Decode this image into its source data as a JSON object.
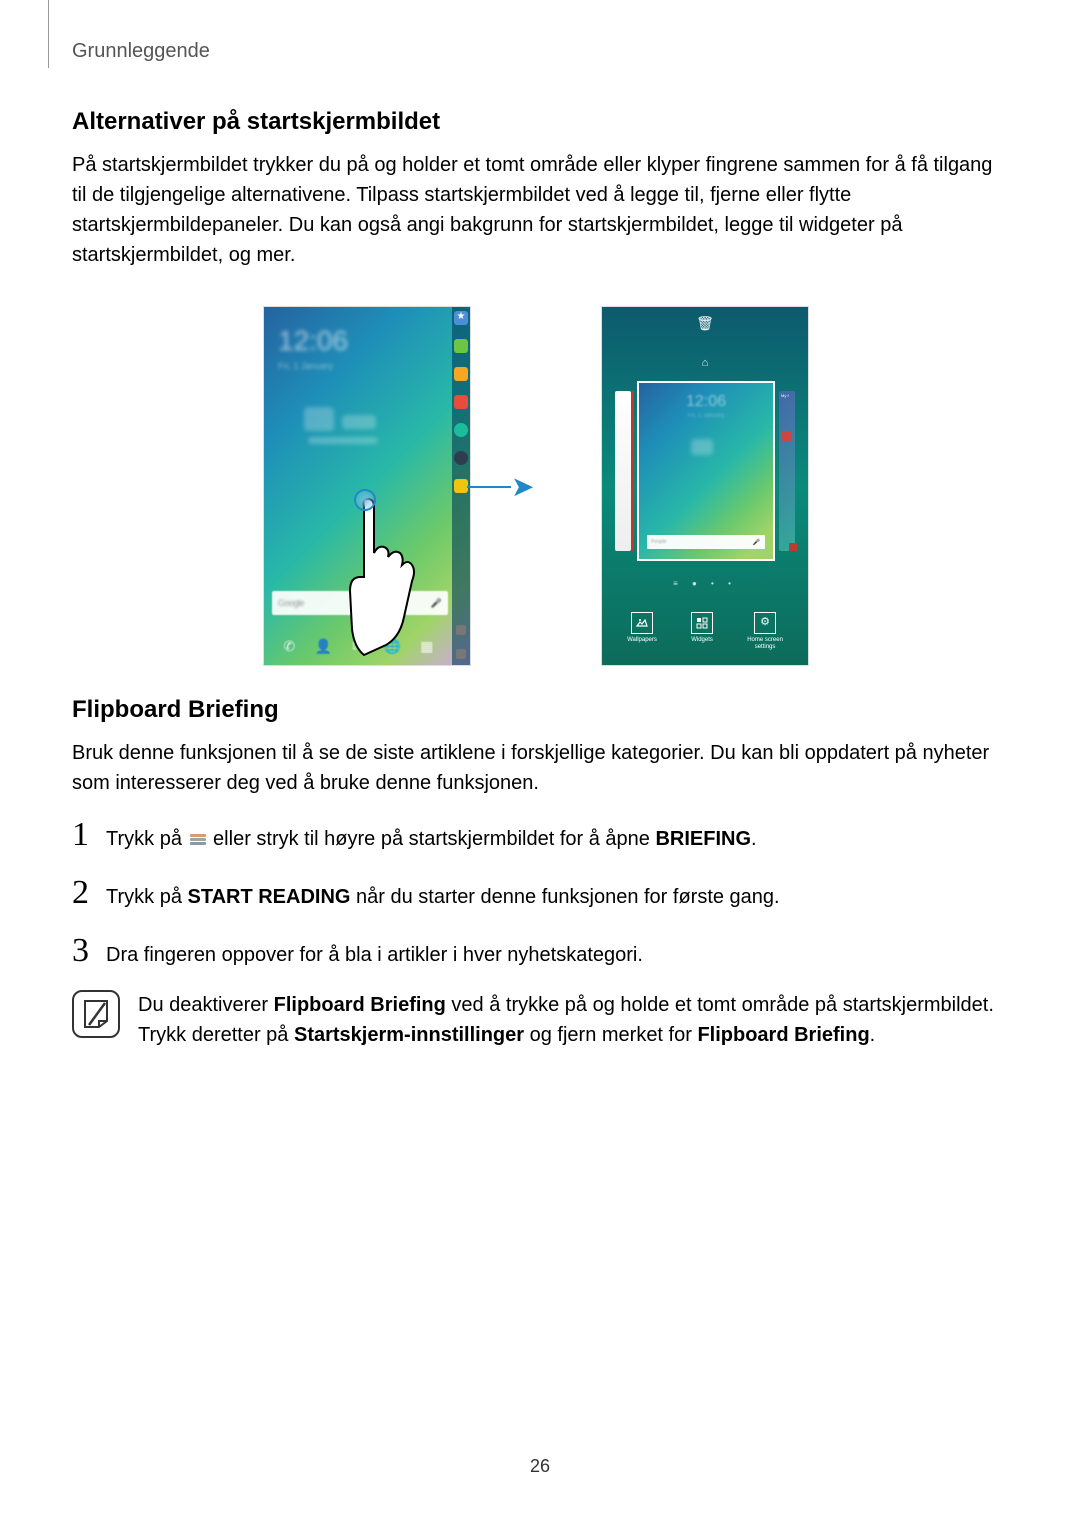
{
  "header": "Grunnleggende",
  "section1": {
    "title": "Alternativer på startskjermbildet",
    "body": "På startskjermbildet trykker du på og holder et tomt område eller klyper fingrene sammen for å få tilgang til de tilgjengelige alternativene. Tilpass startskjermbildet ved å legge til, fjerne eller flytte startskjermbildepaneler. Du kan også angi bakgrunn for startskjermbildet, legge til widgeter på startskjermbildet, og mer."
  },
  "figure": {
    "left_clock": "12:06",
    "left_date": "Fri, 1 January",
    "search_label": "Google",
    "right_clock": "12:06",
    "pm_search": "People",
    "actions": {
      "wallpapers": "Wallpapers",
      "widgets": "Widgets",
      "settings_l1": "Home screen",
      "settings_l2": "settings"
    }
  },
  "section2": {
    "title": "Flipboard Briefing",
    "body": "Bruk denne funksjonen til å se de siste artiklene i forskjellige kategorier. Du kan bli oppdatert på nyheter som interesserer deg ved å bruke denne funksjonen."
  },
  "steps": {
    "n1": "1",
    "s1a": "Trykk på ",
    "s1b": " eller stryk til høyre på startskjermbildet for å åpne ",
    "s1c": "BRIEFING",
    "s1d": ".",
    "n2": "2",
    "s2a": "Trykk på ",
    "s2b": "START READING",
    "s2c": " når du starter denne funksjonen for første gang.",
    "n3": "3",
    "s3": "Dra fingeren oppover for å bla i artikler i hver nyhetskategori."
  },
  "note": {
    "a": "Du deaktiverer ",
    "b": "Flipboard Briefing",
    "c": " ved å trykke på og holde et tomt område på startskjermbildet. Trykk deretter på ",
    "d": "Startskjerm-innstillinger",
    "e": " og fjern merket for ",
    "f": "Flipboard Briefing",
    "g": "."
  },
  "page_number": "26"
}
